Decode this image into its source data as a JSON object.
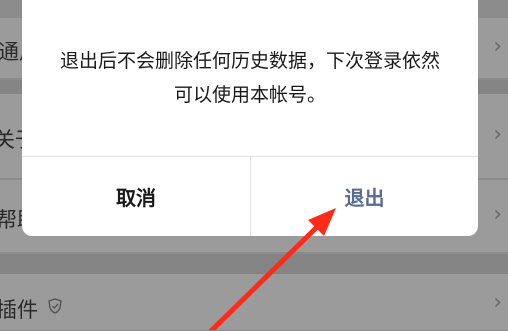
{
  "background_list": {
    "rows": [
      {
        "label": "通用",
        "chevron": "›"
      },
      {
        "label": "关于",
        "chevron": "›"
      },
      {
        "label": "帮助",
        "chevron": "›"
      },
      {
        "label": "插件",
        "chevron": "›",
        "badge_icon": "shield-icon"
      }
    ]
  },
  "dialog": {
    "message": "退出后不会删除任何历史数据，下次登录依然可以使用本帐号。",
    "cancel_label": "取消",
    "confirm_label": "退出"
  },
  "colors": {
    "confirm_text": "#576b95",
    "annotation_arrow": "#ff2a1a"
  }
}
